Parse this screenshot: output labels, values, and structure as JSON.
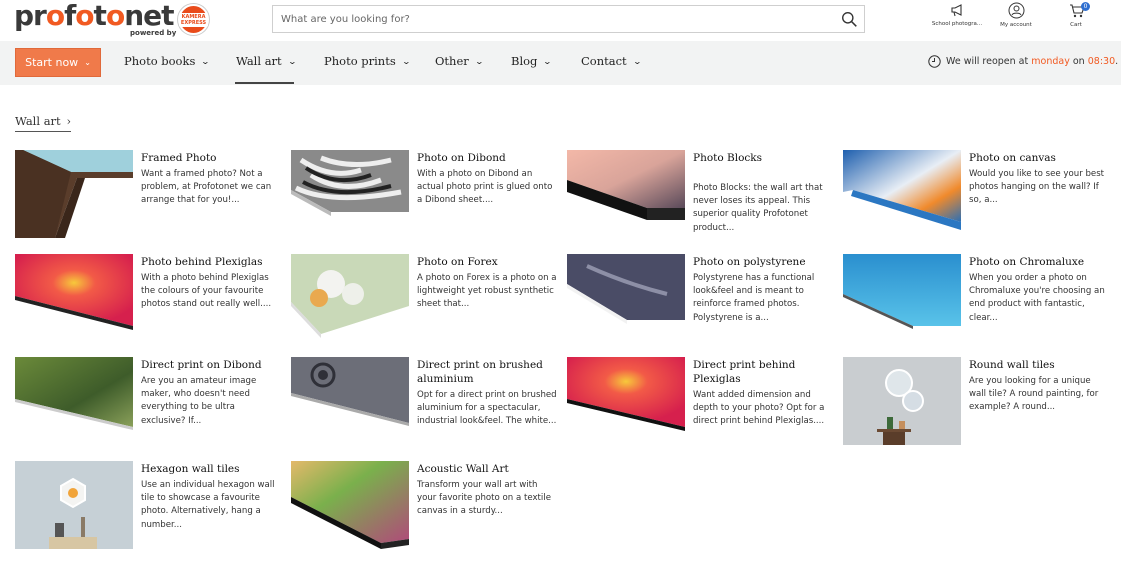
{
  "brand": {
    "logo_main": "profotonet",
    "logo_tagline": "powered by",
    "partner_badge": "KAMERA EXPRESS"
  },
  "search": {
    "placeholder": "What are you looking for?",
    "icon": "search-icon"
  },
  "utility": [
    {
      "label": "School photogra...",
      "icon": "megaphone-icon"
    },
    {
      "label": "My account",
      "icon": "user-icon"
    },
    {
      "label": "Cart",
      "icon": "cart-icon",
      "count": "0"
    }
  ],
  "nav": {
    "start_label": "Start now",
    "items": [
      "Photo books",
      "Wall art",
      "Photo prints",
      "Other",
      "Blog",
      "Contact"
    ],
    "active": "Wall art"
  },
  "status": {
    "prefix": "We will reopen at",
    "day": "monday",
    "on": "on",
    "time": "08:30",
    "suffix": "."
  },
  "breadcrumb": {
    "label": "Wall art"
  },
  "products": [
    {
      "title": "Framed Photo",
      "desc": "Want a framed photo? Not a problem, at Profotonet we can arrange that for you!..."
    },
    {
      "title": "Photo on Dibond",
      "desc": "With a photo on Dibond an actual photo print is glued onto a Dibond sheet...."
    },
    {
      "title": "Photo Blocks",
      "desc": "Photo Blocks: the wall art that never loses its appeal. This superior quality Profotonet product..."
    },
    {
      "title": "Photo on canvas",
      "desc": "Would you like to see your best photos hanging on the wall? If so, a..."
    },
    {
      "title": "Photo behind Plexiglas",
      "desc": "With a photo behind Plexiglas the colours of your favourite photos stand out really well...."
    },
    {
      "title": "Photo on Forex",
      "desc": "A photo on Forex is a photo on a lightweight yet robust synthetic sheet that..."
    },
    {
      "title": "Photo on polystyrene",
      "desc": "Polystyrene has a functional look&feel and is meant to reinforce framed photos. Polystyrene is a..."
    },
    {
      "title": "Photo on Chromaluxe",
      "desc": "When you order a photo on Chromaluxe you're choosing an end product with fantastic, clear..."
    },
    {
      "title": "Direct print on Dibond",
      "desc": "Are you an amateur image maker, who doesn't need everything to be ultra exclusive? If..."
    },
    {
      "title": "Direct print on brushed aluminium",
      "desc": "Opt for a direct print on brushed aluminium for a spectacular, industrial look&feel. The white..."
    },
    {
      "title": "Direct print behind Plexiglas",
      "desc": "Want added dimension and depth to your photo? Opt for a direct print behind Plexiglas...."
    },
    {
      "title": "Round wall tiles",
      "desc": "Are you looking for a unique wall tile? A round painting, for example? A round..."
    },
    {
      "title": "Hexagon wall tiles",
      "desc": "Use an individual hexagon wall tile to showcase a favourite photo. Alternatively, hang a number..."
    },
    {
      "title": "Acoustic Wall Art",
      "desc": "Transform your wall art with your favorite photo on a textile canvas in a sturdy..."
    }
  ]
}
